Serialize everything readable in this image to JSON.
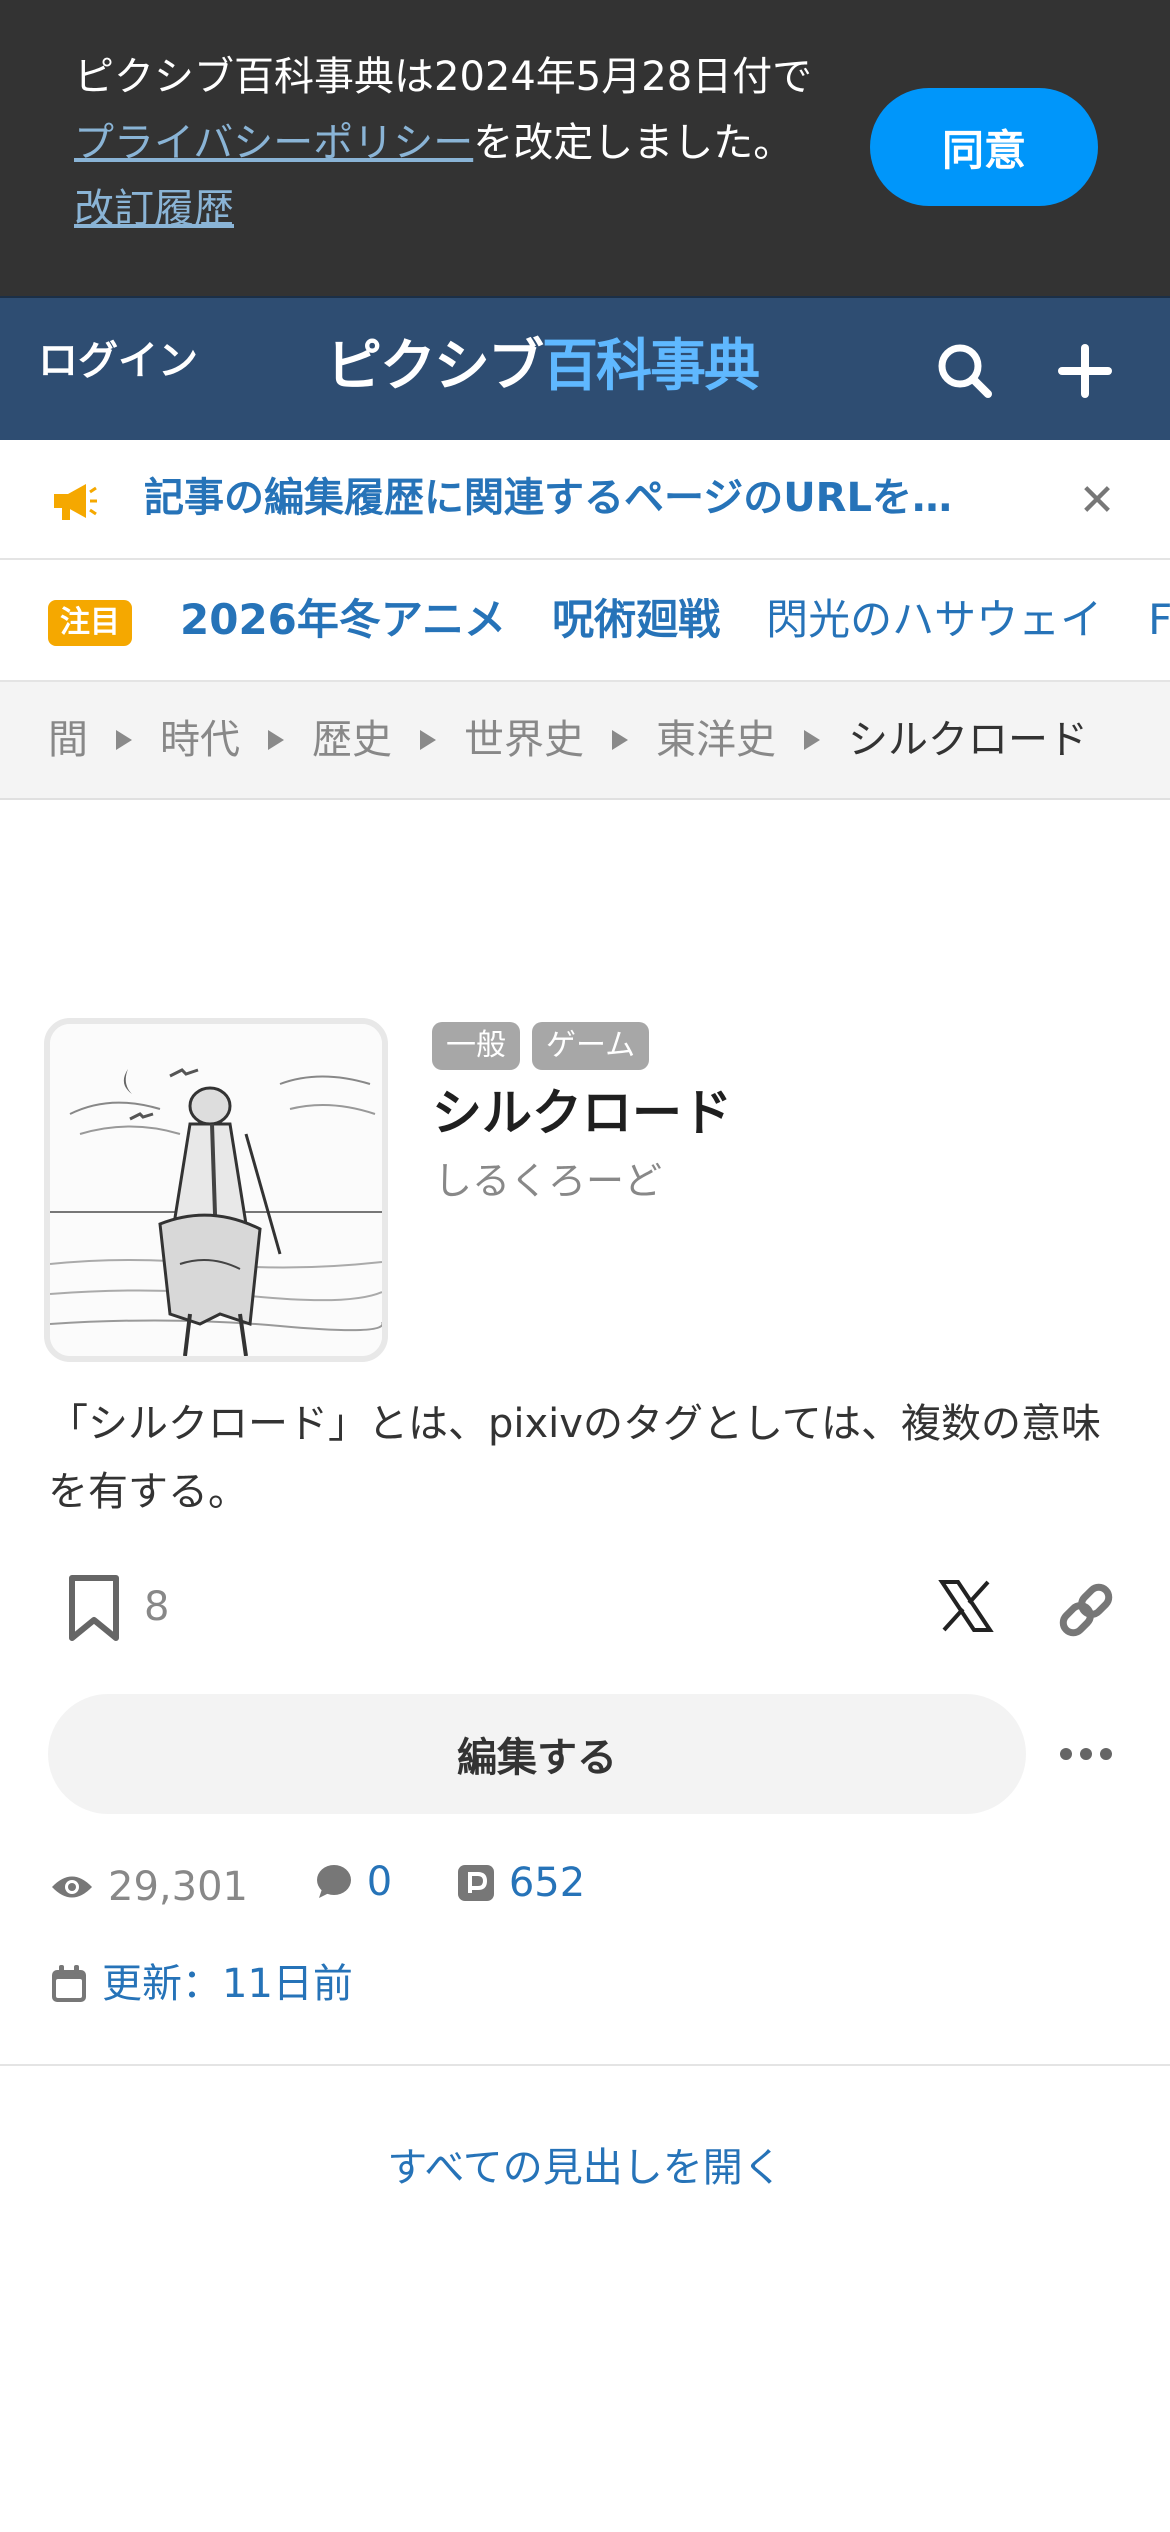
{
  "consent": {
    "text_before": "ピクシブ百科事典は2024年5月28日付で",
    "privacy_link": "プライバシーポリシー",
    "text_after": "を改定しました。",
    "history_link": "改訂履歴",
    "agree_label": "同意"
  },
  "header": {
    "login_label": "ログイン",
    "logo_part1": "ピクシブ",
    "logo_part2": "百科事典"
  },
  "notice": {
    "text": "記事の編集履歴に関連するページのURLを…"
  },
  "trending": {
    "badge": "注目",
    "items": [
      "2026年冬アニメ",
      "呪術廻戦",
      "閃光のハサウェイ",
      "FGO"
    ]
  },
  "breadcrumb": [
    "間",
    "時代",
    "歴史",
    "世界史",
    "東洋史",
    "シルクロード"
  ],
  "article": {
    "tags": [
      "一般",
      "ゲーム"
    ],
    "title": "シルクロード",
    "reading": "しるくろーど",
    "summary": "「シルクロード」とは、pixivのタグとしては、複数の意味を有する。",
    "bookmark_count": "8",
    "edit_label": "編集する",
    "views": "29,301",
    "comments": "0",
    "pixiv_works": "652",
    "updated": "更新：11日前",
    "open_all_headings": "すべての見出しを開く"
  },
  "colors": {
    "header_bg": "#2e4d72",
    "accent_blue": "#2673b8",
    "agree_blue": "#0096fa",
    "hot_badge": "#f5a800"
  }
}
